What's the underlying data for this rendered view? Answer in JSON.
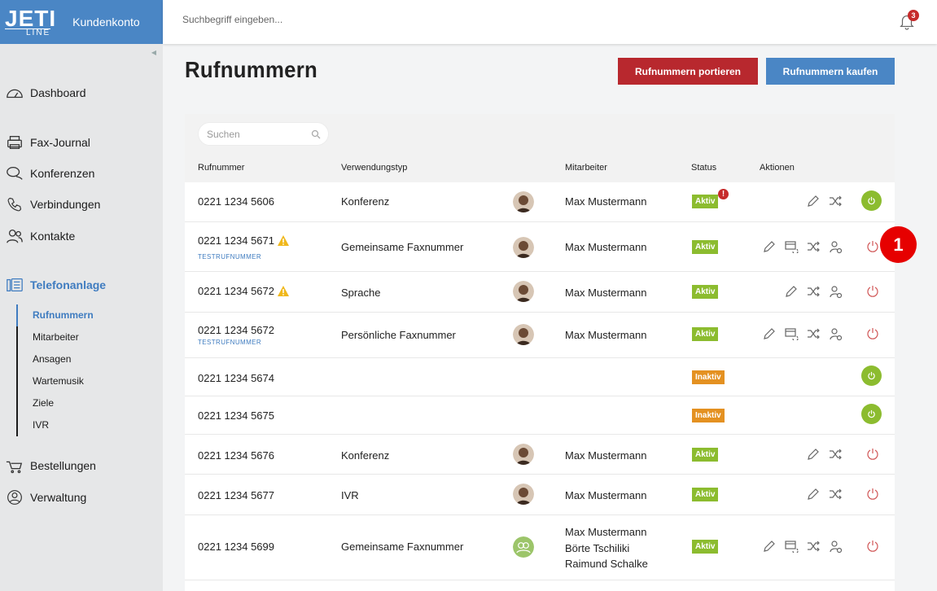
{
  "app": {
    "logo_text": "JETI",
    "logo_sub": "LINE",
    "account_label": "Kundenkonto",
    "search_placeholder": "Suchbegriff eingeben...",
    "notification_count": "3"
  },
  "sidebar": {
    "items": [
      {
        "label": "Dashboard",
        "icon": "dashboard-icon"
      },
      {
        "label": "Fax-Journal",
        "icon": "fax-icon"
      },
      {
        "label": "Konferenzen",
        "icon": "conference-icon"
      },
      {
        "label": "Verbindungen",
        "icon": "phone-icon"
      },
      {
        "label": "Kontakte",
        "icon": "contacts-icon"
      },
      {
        "label": "Telefonanlage",
        "icon": "pbx-icon"
      },
      {
        "label": "Bestellungen",
        "icon": "cart-icon"
      },
      {
        "label": "Verwaltung",
        "icon": "user-circle-icon"
      }
    ],
    "subitems": [
      "Rufnummern",
      "Mitarbeiter",
      "Ansagen",
      "Wartemusik",
      "Ziele",
      "IVR"
    ]
  },
  "main": {
    "title": "Rufnummern",
    "port_button": "Rufnummern portieren",
    "buy_button": "Rufnummern kaufen",
    "search_placeholder": "Suchen",
    "columns": {
      "number": "Rufnummer",
      "type": "Verwendungstyp",
      "employee": "Mitarbeiter",
      "status": "Status",
      "actions": "Aktionen"
    },
    "rows": [
      {
        "number": "0221 1234 5606",
        "type": "Konferenz",
        "employee": "Max Mustermann",
        "status": "Aktiv"
      },
      {
        "number": "0221 1234 5671",
        "sub": "TESTRUFNUMMER",
        "type": "Gemeinsame Faxnummer",
        "employee": "Max Mustermann",
        "status": "Aktiv"
      },
      {
        "number": "0221 1234 5672",
        "type": "Sprache",
        "employee": "Max Mustermann",
        "status": "Aktiv"
      },
      {
        "number": "0221 1234 5672",
        "sub": "TESTRUFNUMMER",
        "type": "Persönliche Faxnummer",
        "employee": "Max Mustermann",
        "status": "Aktiv"
      },
      {
        "number": "0221 1234 5674",
        "type": "",
        "employee": "",
        "status": "Inaktiv"
      },
      {
        "number": "0221 1234 5675",
        "type": "",
        "employee": "",
        "status": "Inaktiv"
      },
      {
        "number": "0221 1234 5676",
        "type": "Konferenz",
        "employee": "Max Mustermann",
        "status": "Aktiv"
      },
      {
        "number": "0221 1234 5677",
        "type": "IVR",
        "employee": "Max Mustermann",
        "status": "Aktiv"
      },
      {
        "number": "0221 1234 5699",
        "type": "Gemeinsame Faxnummer",
        "employees": [
          "Max Mustermann",
          "Börte Tschiliki",
          "Raimund Schalke"
        ],
        "status": "Aktiv"
      }
    ],
    "alert_mark": "!",
    "callout_number": "1"
  },
  "colors": {
    "brand": "#4a86c5",
    "danger": "#b8282e",
    "active": "#8cbc2f",
    "inactive": "#e49121"
  }
}
